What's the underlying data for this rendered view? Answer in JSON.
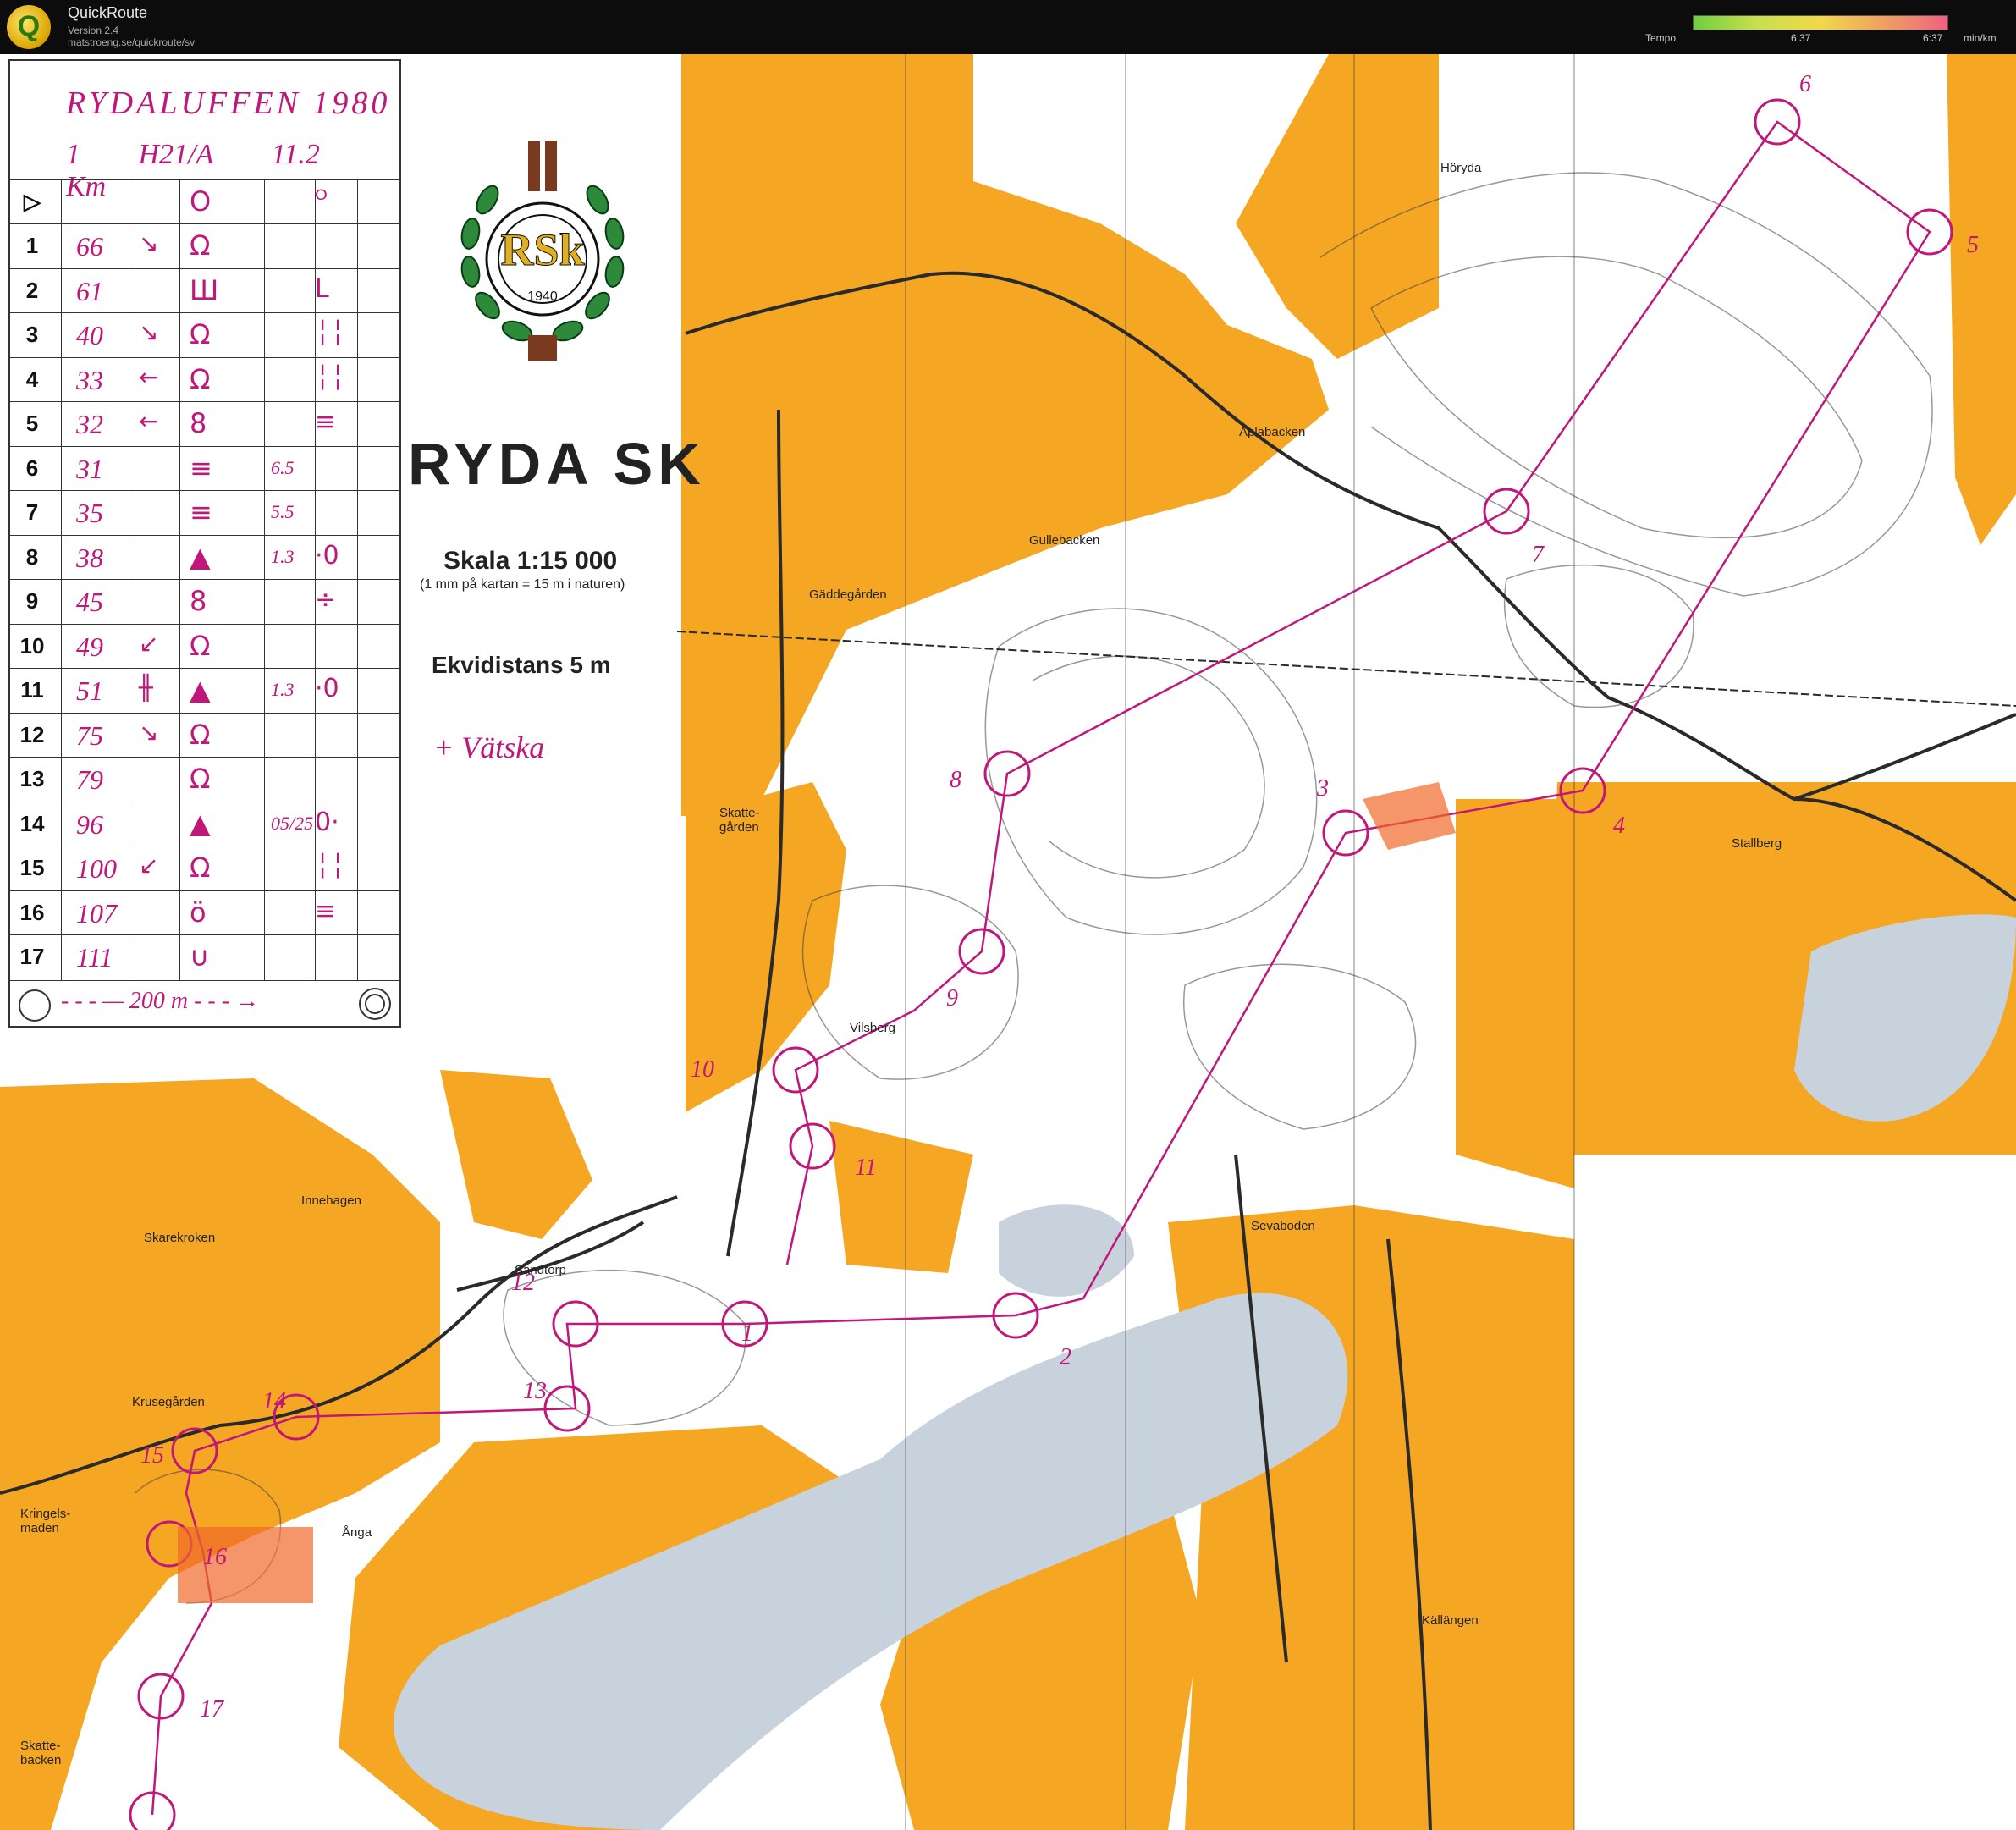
{
  "app": {
    "title": "QuickRoute",
    "version": "Version 2.4",
    "url": "matstroeng.se/quickroute/sv",
    "tempo_label": "Tempo",
    "tempo_left": "6:37",
    "tempo_right": "6:37",
    "tempo_unit": "min/km",
    "tempo_colors": [
      "#6fce3f",
      "#c8e04a",
      "#f1d84a",
      "#f0a060",
      "#f06080"
    ]
  },
  "card": {
    "event": "RYDALUFFEN 1980",
    "class_parts": [
      "1",
      "H21/A",
      "11.2 Km"
    ],
    "start_symbol": "▷",
    "start_code": "O",
    "start_extra": "ᴼ",
    "rows": [
      {
        "n": "1",
        "code": "66",
        "dir": "↘",
        "sym": "Ω",
        "dim": "",
        "extra": ""
      },
      {
        "n": "2",
        "code": "61",
        "dir": "",
        "sym": "Ш",
        "dim": "",
        "extra": "L"
      },
      {
        "n": "3",
        "code": "40",
        "dir": "↘",
        "sym": "Ω",
        "dim": "",
        "extra": "╎╎"
      },
      {
        "n": "4",
        "code": "33",
        "dir": "←",
        "sym": "Ω",
        "dim": "",
        "extra": "╎╎"
      },
      {
        "n": "5",
        "code": "32",
        "dir": "←",
        "sym": "8",
        "dim": "",
        "extra": "≡"
      },
      {
        "n": "6",
        "code": "31",
        "dir": "",
        "sym": "≡",
        "dim": "6.5",
        "extra": ""
      },
      {
        "n": "7",
        "code": "35",
        "dir": "",
        "sym": "≡",
        "dim": "5.5",
        "extra": ""
      },
      {
        "n": "8",
        "code": "38",
        "dir": "",
        "sym": "▲",
        "dim": "1.3",
        "extra": "·0"
      },
      {
        "n": "9",
        "code": "45",
        "dir": "",
        "sym": "8",
        "dim": "",
        "extra": "÷"
      },
      {
        "n": "10",
        "code": "49",
        "dir": "↙",
        "sym": "Ω",
        "dim": "",
        "extra": ""
      },
      {
        "n": "11",
        "code": "51",
        "dir": "╫",
        "sym": "▲",
        "dim": "1.3",
        "extra": "·0"
      },
      {
        "n": "12",
        "code": "75",
        "dir": "↘",
        "sym": "Ω",
        "dim": "",
        "extra": ""
      },
      {
        "n": "13",
        "code": "79",
        "dir": "",
        "sym": "Ω",
        "dim": "",
        "extra": ""
      },
      {
        "n": "14",
        "code": "96",
        "dir": "",
        "sym": "▲",
        "dim": "05/25",
        "extra": "0·"
      },
      {
        "n": "15",
        "code": "100",
        "dir": "↙",
        "sym": "Ω",
        "dim": "",
        "extra": "╎╎"
      },
      {
        "n": "16",
        "code": "107",
        "dir": "",
        "sym": "ö",
        "dim": "",
        "extra": "≡"
      },
      {
        "n": "17",
        "code": "111",
        "dir": "",
        "sym": "∪",
        "dim": "",
        "extra": ""
      }
    ],
    "finish_text": "- - - — 200 m - - - →"
  },
  "club": {
    "name": "RYDA SK",
    "logo_text": "RSk",
    "logo_year": "1940",
    "scale": "Skala 1:15 000",
    "scale_note": "(1 mm på kartan = 15 m i naturen)",
    "equidistance": "Ekvidistans 5 m",
    "water_note": "+ Vätska"
  },
  "places": [
    "Höryda",
    "Aplabacken",
    "Gullebacken",
    "Gäddegården",
    "Skatte-gården",
    "Stallberg",
    "Vilsberg",
    "Innehagen",
    "Skarekroken",
    "Sandtorp",
    "Sevaboden",
    "Krusegården",
    "Kringels-maden",
    "Ånga",
    "Källängen",
    "Skatte-backen"
  ],
  "control_labels": [
    "1",
    "2",
    "3",
    "4",
    "5",
    "6",
    "7",
    "8",
    "9",
    "10",
    "11",
    "12",
    "13",
    "14",
    "15",
    "16",
    "17"
  ],
  "colors": {
    "open_land": "#f5a623",
    "forest": "#ffffff",
    "water": "#c8d2dc",
    "course": "#c0187a",
    "road": "#2a2a2a"
  }
}
